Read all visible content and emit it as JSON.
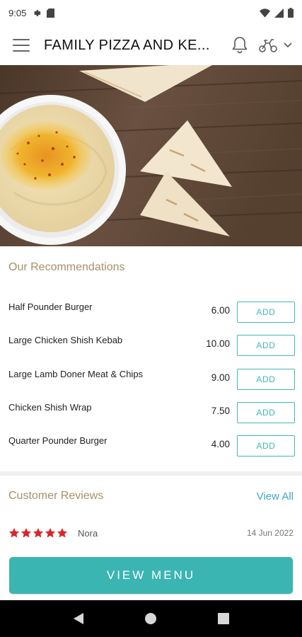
{
  "status_bar": {
    "time": "9:05"
  },
  "header": {
    "title": "FAMILY PIZZA AND KE..."
  },
  "recommendations": {
    "title": "Our Recommendations",
    "items": [
      {
        "name": "Half Pounder Burger",
        "price": "6.00",
        "button": "ADD"
      },
      {
        "name": "Large Chicken Shish Kebab",
        "price": "10.00",
        "button": "ADD"
      },
      {
        "name": "Large Lamb Doner Meat & Chips",
        "price": "9.00",
        "button": "ADD"
      },
      {
        "name": "Chicken Shish Wrap",
        "price": "7.50",
        "button": "ADD"
      },
      {
        "name": "Quarter Pounder Burger",
        "price": "4.00",
        "button": "ADD"
      }
    ]
  },
  "reviews": {
    "title": "Customer Reviews",
    "view_all": "View All",
    "items": [
      {
        "stars": 5,
        "name": "Nora",
        "date": "14 Jun 2022"
      }
    ]
  },
  "view_menu_label": "VIEW MENU",
  "colors": {
    "accent": "#3ab5b2",
    "section_title": "#a89066",
    "link": "#3fa6c4",
    "star": "#d9262c"
  },
  "icons": {
    "menu": "hamburger-icon",
    "bell": "bell-icon",
    "delivery": "scooter-icon",
    "dropdown": "chevron-down-icon"
  }
}
